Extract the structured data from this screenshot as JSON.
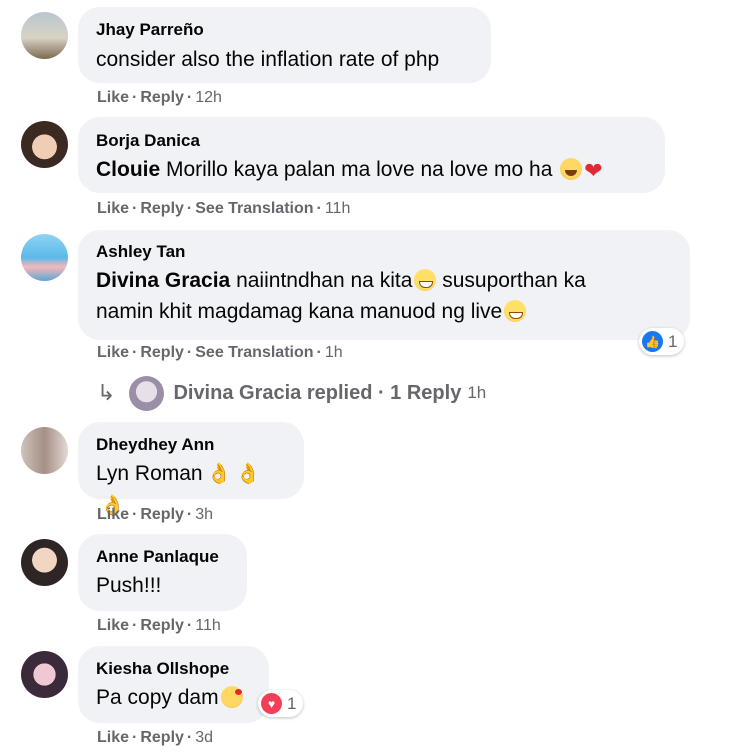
{
  "comments": [
    {
      "author": "Jhay Parreño",
      "mention": "",
      "text": "consider also the inflation rate of php",
      "actions": {
        "like": "Like",
        "reply": "Reply",
        "translate": "",
        "time": "12h"
      }
    },
    {
      "author": "Borja Danica",
      "mention": "Clouie",
      "text": " Morillo kaya palan ma love na love mo ha",
      "actions": {
        "like": "Like",
        "reply": "Reply",
        "translate": "See Translation",
        "time": "11h"
      }
    },
    {
      "author": "Ashley Tan",
      "mention": "Divina Gracia",
      "text_line1": " naiintndhan na kita",
      "text_line1b": " susuporthan ka",
      "text_line2": "namin khit magdamag kana manuod ng live",
      "actions": {
        "like": "Like",
        "reply": "Reply",
        "translate": "See Translation",
        "time": "1h"
      },
      "reactions": {
        "icon": "like-icon",
        "count": "1"
      }
    },
    {
      "author": "Dheydhey Ann",
      "mention": "",
      "text": "Lyn Roman",
      "actions": {
        "like": "Like",
        "reply": "Reply",
        "translate": "",
        "time": "3h"
      }
    },
    {
      "author": "Anne Panlaque",
      "mention": "",
      "text": "Push!!!",
      "actions": {
        "like": "Like",
        "reply": "Reply",
        "translate": "",
        "time": "11h"
      }
    },
    {
      "author": "Kiesha Ollshope",
      "mention": "",
      "text": "Pa copy dam",
      "actions": {
        "like": "Like",
        "reply": "Reply",
        "translate": "",
        "time": "3d"
      },
      "reactions": {
        "icon": "love-icon",
        "count": "1"
      }
    }
  ],
  "reply_thread": {
    "text": "Divina Gracia replied · 1 Reply",
    "time": "1h"
  },
  "colors": {
    "bubble": "#f0f2f5",
    "meta": "#65676b",
    "like_blue": "#1877f2",
    "love_red": "#f33e58"
  }
}
